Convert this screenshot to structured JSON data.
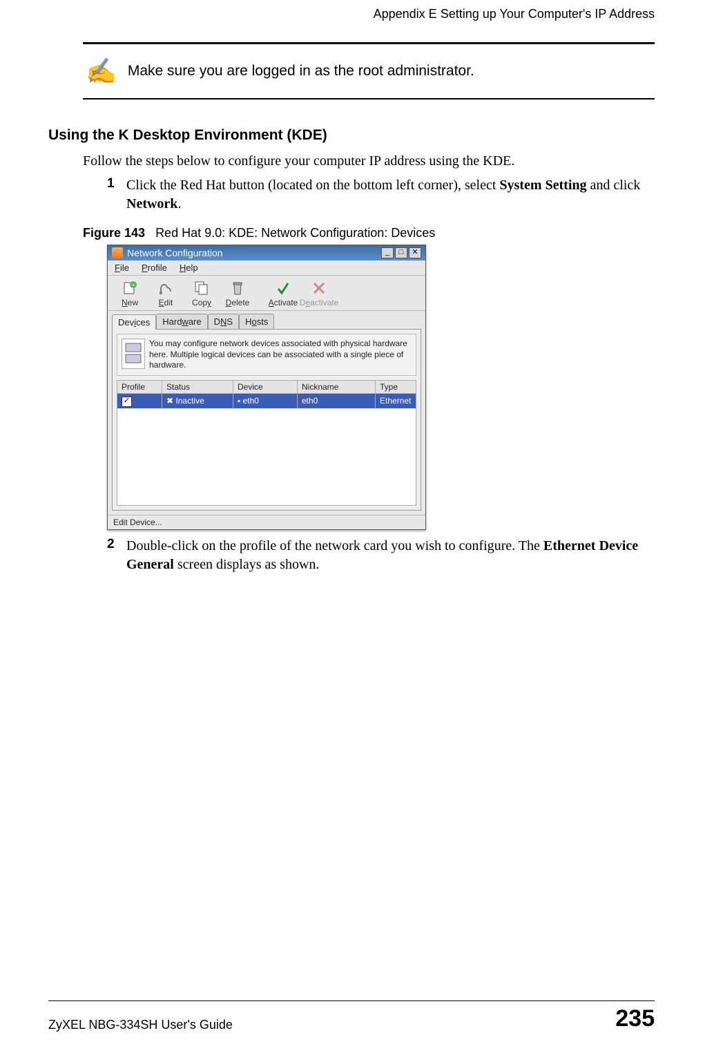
{
  "header": {
    "appendix_title": "Appendix E Setting up Your Computer's IP Address"
  },
  "note": {
    "icon": "✍",
    "text": "Make sure you are logged in as the root administrator."
  },
  "section": {
    "heading": "Using the K Desktop Environment (KDE)",
    "intro": "Follow the steps below to configure your computer IP address using the KDE."
  },
  "steps": {
    "step1": {
      "num": "1",
      "text_before": "Click the Red Hat button (located on the bottom left corner), select ",
      "bold1": "System Setting",
      "text_mid": " and click ",
      "bold2": "Network",
      "text_after": "."
    },
    "step2": {
      "num": "2",
      "text_before": "Double-click on the profile of the network card you wish to configure. The ",
      "bold1": "Ethernet Device General",
      "text_after": " screen displays as shown."
    }
  },
  "figure": {
    "label": "Figure 143",
    "caption": "Red Hat 9.0: KDE: Network Configuration: Devices"
  },
  "kde": {
    "title": "Network Configuration",
    "title_btns": {
      "min": "_",
      "max": "□",
      "close": "✕"
    },
    "menubar": {
      "file": "File",
      "profile": "Profile",
      "help": "Help"
    },
    "toolbar": {
      "new": "New",
      "edit": "Edit",
      "copy": "Copy",
      "delete": "Delete",
      "activate": "Activate",
      "deactivate": "Deactivate"
    },
    "tabs": {
      "devices": "Devices",
      "hardware": "Hardware",
      "dns": "DNS",
      "hosts": "Hosts"
    },
    "info_text": "You may configure network devices associated with physical hardware here.  Multiple logical devices can be associated with a single piece of hardware.",
    "columns": {
      "profile": "Profile",
      "status": "Status",
      "device": "Device",
      "nickname": "Nickname",
      "type": "Type"
    },
    "row": {
      "check": "✓",
      "status": "Inactive",
      "device": "eth0",
      "nickname": "eth0",
      "type": "Ethernet"
    },
    "statusbar": "Edit Device..."
  },
  "footer": {
    "guide": "ZyXEL NBG-334SH User's Guide",
    "page": "235"
  }
}
